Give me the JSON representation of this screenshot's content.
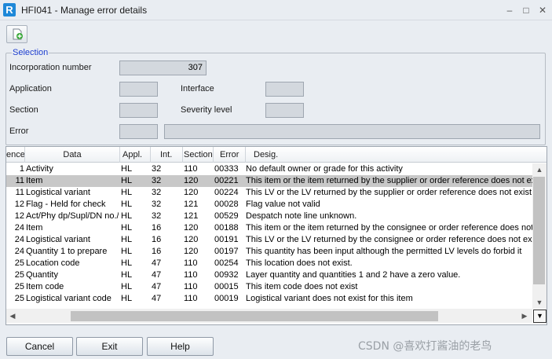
{
  "window": {
    "logo": "R",
    "title": "HFI041 - Manage error details",
    "minimize": "–",
    "maximize": "□",
    "close": "✕"
  },
  "selection": {
    "legend": "Selection",
    "incorporation_label": "Incorporation number",
    "incorporation_value": "307",
    "application_label": "Application",
    "application_value": "",
    "interface_label": "Interface",
    "interface_value": "",
    "section_label": "Section",
    "section_value": "",
    "severity_label": "Severity level",
    "severity_value": "",
    "error_label": "Error",
    "error_code": "",
    "error_text": ""
  },
  "grid": {
    "columns": [
      "ence",
      "Data",
      "Appl.",
      "Int.",
      "Section",
      "Error",
      "Desig."
    ],
    "rows": [
      {
        "seq": "1",
        "data": "Activity",
        "appl": "HL",
        "int": "32",
        "section": "110",
        "error": "00333",
        "desig": "No default owner or grade for this activity",
        "selected": false
      },
      {
        "seq": "11",
        "data": "Item",
        "appl": "HL",
        "int": "32",
        "section": "120",
        "error": "00221",
        "desig": "This item or the item returned by the supplier or order reference does not exist",
        "selected": true
      },
      {
        "seq": "11",
        "data": "Logistical variant",
        "appl": "HL",
        "int": "32",
        "section": "120",
        "error": "00224",
        "desig": "This LV or the LV returned by the supplier or order reference does not exist",
        "selected": false
      },
      {
        "seq": "12",
        "data": "Flag - Held for check",
        "appl": "HL",
        "int": "32",
        "section": "121",
        "error": "00028",
        "desig": "Flag value not valid",
        "selected": false
      },
      {
        "seq": "12",
        "data": "Act/Phy dp/Supl/DN no./L",
        "appl": "HL",
        "int": "32",
        "section": "121",
        "error": "00529",
        "desig": "Despatch note line unknown.",
        "selected": false
      },
      {
        "seq": "24",
        "data": "Item",
        "appl": "HL",
        "int": "16",
        "section": "120",
        "error": "00188",
        "desig": "This item or the item returned by the consignee or order reference does not exist",
        "selected": false
      },
      {
        "seq": "24",
        "data": "Logistical variant",
        "appl": "HL",
        "int": "16",
        "section": "120",
        "error": "00191",
        "desig": "This LV or the LV returned by the consignee or order reference does not exist",
        "selected": false
      },
      {
        "seq": "24",
        "data": "Quantity 1 to prepare",
        "appl": "HL",
        "int": "16",
        "section": "120",
        "error": "00197",
        "desig": "This quantity has been input although the permitted LV levels do forbid it",
        "selected": false
      },
      {
        "seq": "25",
        "data": "Location code",
        "appl": "HL",
        "int": "47",
        "section": "110",
        "error": "00254",
        "desig": "This location does not exist.",
        "selected": false
      },
      {
        "seq": "25",
        "data": "Quantity",
        "appl": "HL",
        "int": "47",
        "section": "110",
        "error": "00932",
        "desig": "Layer quantity and quantities 1 and 2 have a zero value.",
        "selected": false
      },
      {
        "seq": "25",
        "data": "Item code",
        "appl": "HL",
        "int": "47",
        "section": "110",
        "error": "00015",
        "desig": "This item code does not exist",
        "selected": false
      },
      {
        "seq": "25",
        "data": "Logistical variant code",
        "appl": "HL",
        "int": "47",
        "section": "110",
        "error": "00019",
        "desig": "Logistical variant does not exist for this item",
        "selected": false
      }
    ]
  },
  "buttons": {
    "cancel": "Cancel",
    "exit": "Exit",
    "help": "Help"
  },
  "watermark": "CSDN @喜欢打酱油的老鸟",
  "icons": {
    "toolbar_add": "add-document-icon",
    "scroll_up": "▲",
    "scroll_down": "▼",
    "scroll_left": "◀",
    "scroll_right": "▶",
    "corner": "▼"
  },
  "colors": {
    "selected_row": "#c8c8c8",
    "legend_blue": "#1d3ecf",
    "logo_blue": "#1e88d8"
  }
}
